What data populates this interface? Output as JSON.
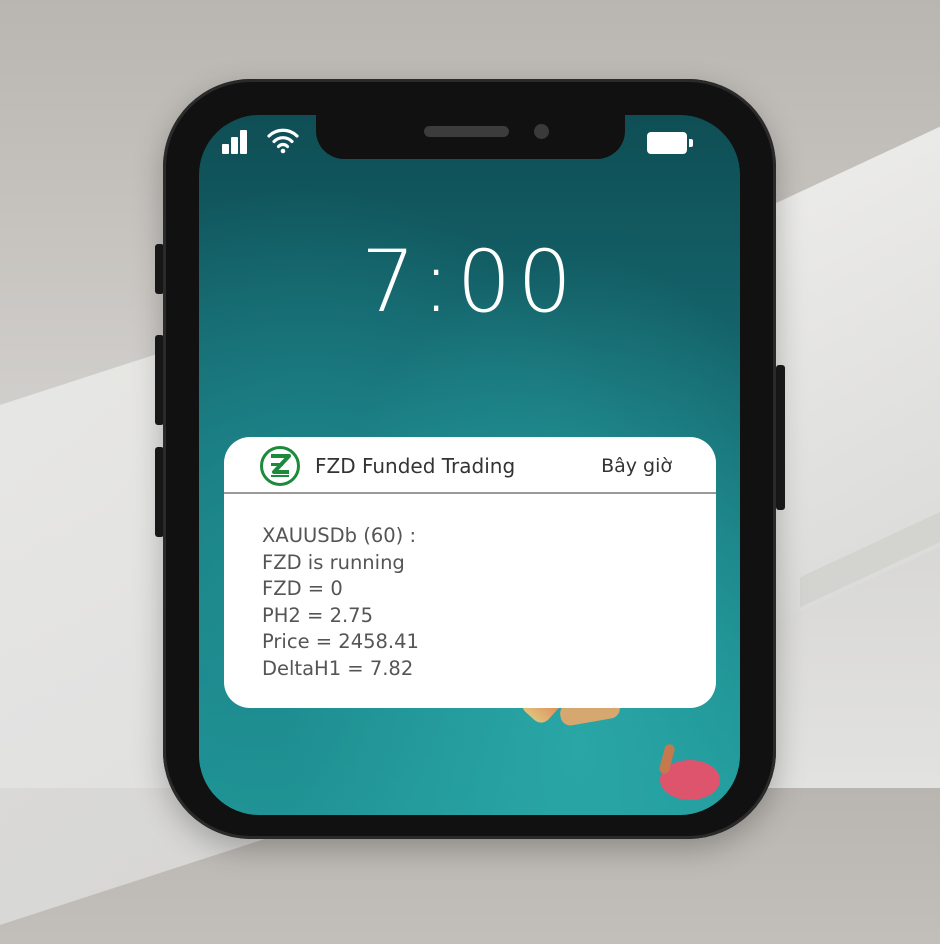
{
  "status_bar": {
    "signal_icon": "cellular-signal-icon",
    "wifi_icon": "wifi-icon",
    "battery_icon": "battery-icon"
  },
  "lock_screen": {
    "time": "7:00"
  },
  "notification": {
    "app_icon": "fzd-logo-icon",
    "app_name": "FZD Funded Trading",
    "timestamp": "Bây giờ",
    "lines": [
      "XAUUSDb (60) :",
      "FZD is running",
      "FZD = 0",
      "PH2 = 2.75",
      "Price = 2458.41",
      "DeltaH1 = 7.82"
    ]
  },
  "colors": {
    "logo_green": "#1b8a3a",
    "screen_teal": "#17747a",
    "notification_bg": "#ffffff"
  }
}
